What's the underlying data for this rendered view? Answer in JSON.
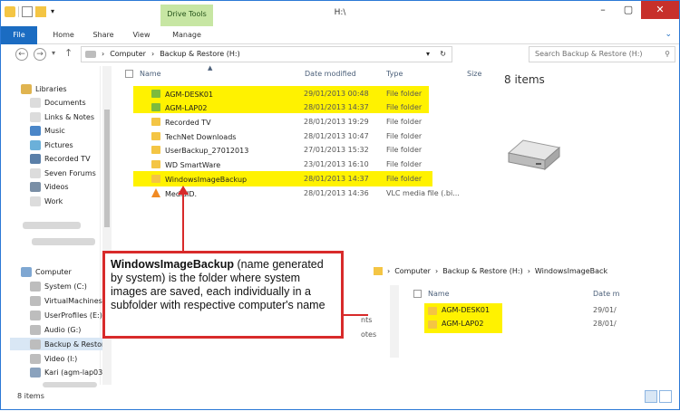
{
  "window": {
    "title": "H:\\",
    "contextual_tab": "Drive Tools"
  },
  "ribbon": {
    "tabs": [
      "File",
      "Home",
      "Share",
      "View",
      "Manage"
    ]
  },
  "address": {
    "crumbs": [
      "Computer",
      "Backup & Restore (H:)"
    ]
  },
  "search": {
    "placeholder": "Search Backup & Restore (H:)"
  },
  "columns": {
    "name": "Name",
    "date": "Date modified",
    "type": "Type",
    "size": "Size"
  },
  "files": [
    {
      "name": "AGM-DESK01",
      "date": "29/01/2013 00:48",
      "type": "File folder",
      "highlight": true,
      "icon": "folder-icon"
    },
    {
      "name": "AGM-LAP02",
      "date": "28/01/2013 14:37",
      "type": "File folder",
      "highlight": true,
      "icon": "folder-icon"
    },
    {
      "name": "Recorded TV",
      "date": "28/01/2013 19:29",
      "type": "File folder",
      "icon": "folder-icon"
    },
    {
      "name": "TechNet Downloads",
      "date": "28/01/2013 10:47",
      "type": "File folder",
      "icon": "folder-icon"
    },
    {
      "name": "UserBackup_27012013",
      "date": "27/01/2013 15:32",
      "type": "File folder",
      "icon": "folder-icon"
    },
    {
      "name": "WD SmartWare",
      "date": "23/01/2013 16:10",
      "type": "File folder",
      "icon": "folder-icon"
    },
    {
      "name": "WindowsImageBackup",
      "date": "28/01/2013 14:37",
      "type": "File folder",
      "highlight": true,
      "icon": "folder-icon"
    },
    {
      "name": "MediaID.",
      "date": "28/01/2013 14:36",
      "type": "VLC media file (.bi...",
      "icon": "vlc-icon"
    }
  ],
  "details": {
    "count": "8 items"
  },
  "nav": {
    "libraries": {
      "label": "Libraries",
      "items": [
        "Documents",
        "Links & Notes",
        "Music",
        "Pictures",
        "Recorded TV",
        "Seven Forums",
        "Videos",
        "Work"
      ]
    },
    "computer": {
      "label": "Computer",
      "items": [
        "System (C:)",
        "VirtualMachines",
        "UserProfiles (E:)",
        "Audio (G:)",
        "Backup & Restor",
        "Video (I:)",
        "Kari (agm-lap03)"
      ]
    }
  },
  "status": {
    "count": "8 items"
  },
  "callout": {
    "bold": "WindowsImageBackup",
    "text": " (name generated by system) is the folder where system images are saved, each individually in a subfolder with respective computer's name"
  },
  "inset": {
    "crumbs": [
      "Computer",
      "Backup & Restore (H:)",
      "WindowsImageBack"
    ],
    "name_header": "Name",
    "date_header": "Date m",
    "left_fragments": [
      "nts",
      "otes"
    ],
    "rows": [
      {
        "name": "AGM-DESK01",
        "date": "29/01/"
      },
      {
        "name": "AGM-LAP02",
        "date": "28/01/"
      }
    ]
  },
  "colors": {
    "highlight": "#fff200",
    "accent": "#1b6cc2",
    "callout_border": "#d82a2a",
    "close": "#c7302b"
  }
}
